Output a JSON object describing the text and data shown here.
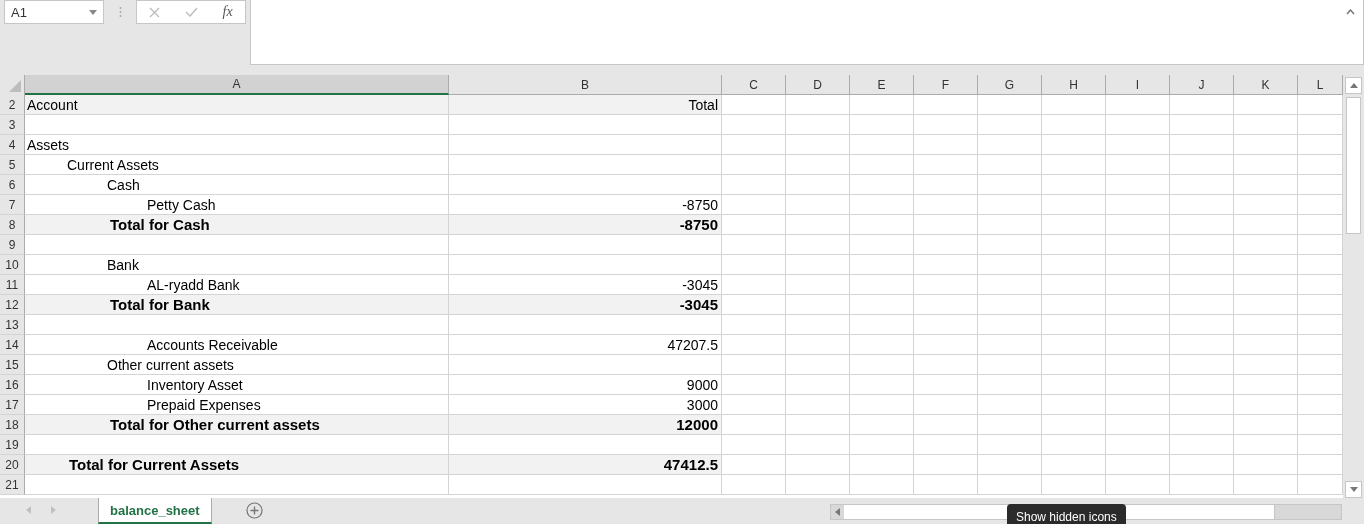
{
  "name_box": {
    "value": "A1"
  },
  "formula_bar": {
    "fx": "fx"
  },
  "columns": [
    "A",
    "B",
    "C",
    "D",
    "E",
    "F",
    "G",
    "H",
    "I",
    "J",
    "K",
    "L"
  ],
  "rows": [
    {
      "number": "2",
      "kind": "header",
      "account": "Account",
      "total": "Total"
    },
    {
      "number": "3",
      "kind": "blank"
    },
    {
      "number": "4",
      "kind": "top",
      "account": "Assets"
    },
    {
      "number": "5",
      "kind": "section",
      "account": "Current Assets"
    },
    {
      "number": "6",
      "kind": "group",
      "account": "Cash"
    },
    {
      "number": "7",
      "kind": "item",
      "account": "Petty Cash",
      "total": "-8750"
    },
    {
      "number": "8",
      "kind": "group_total",
      "account": "Total for Cash",
      "total": "-8750"
    },
    {
      "number": "9",
      "kind": "blank"
    },
    {
      "number": "10",
      "kind": "group",
      "account": "Bank"
    },
    {
      "number": "11",
      "kind": "item",
      "account": "AL-ryadd Bank",
      "total": "-3045"
    },
    {
      "number": "12",
      "kind": "group_total",
      "account": "Total for Bank",
      "total": "-3045"
    },
    {
      "number": "13",
      "kind": "blank"
    },
    {
      "number": "14",
      "kind": "item",
      "account": "Accounts Receivable",
      "total": "47207.5"
    },
    {
      "number": "15",
      "kind": "group",
      "account": "Other current assets"
    },
    {
      "number": "16",
      "kind": "item",
      "account": "Inventory Asset",
      "total": "9000"
    },
    {
      "number": "17",
      "kind": "item",
      "account": "Prepaid Expenses",
      "total": "3000"
    },
    {
      "number": "18",
      "kind": "group_total",
      "account": "Total for Other current assets",
      "total": "12000"
    },
    {
      "number": "19",
      "kind": "blank"
    },
    {
      "number": "20",
      "kind": "section_total",
      "account": "Total for Current Assets",
      "total": "47412.5"
    },
    {
      "number": "21",
      "kind": "blank"
    }
  ],
  "sheet_tabs": [
    {
      "label": "balance_sheet",
      "selected": true
    }
  ],
  "tooltip": "Show hidden icons"
}
